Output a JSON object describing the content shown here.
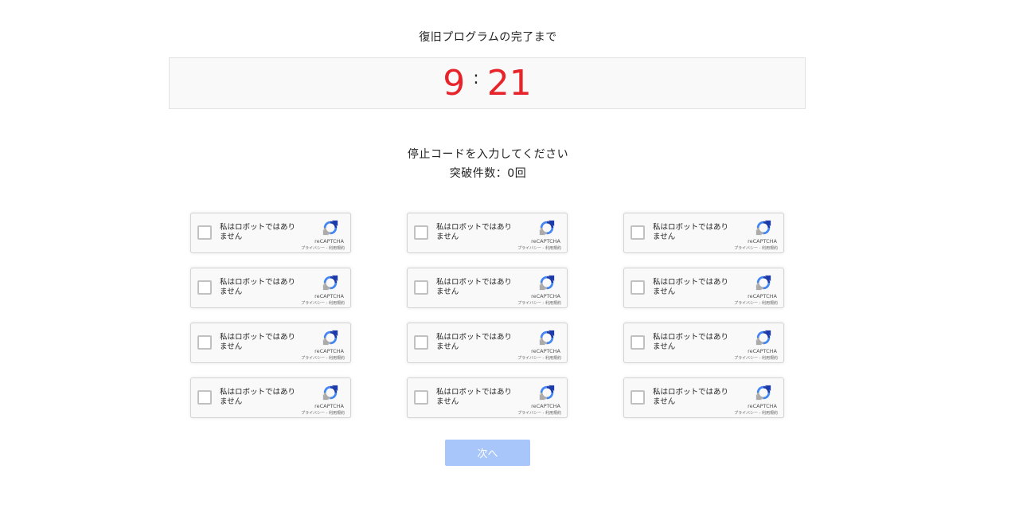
{
  "header": {
    "title": "復旧プログラムの完了まで"
  },
  "timer": {
    "minutes": "9",
    "separator": ":",
    "seconds": "21"
  },
  "instructions": {
    "line1": "停止コードを入力してください",
    "line2": "突破件数：0回"
  },
  "captcha": {
    "label": "私はロボットではありません",
    "brand": "reCAPTCHA",
    "terms": "プライバシー - 利用規約",
    "count": 12,
    "checked": false
  },
  "next_button": {
    "label": "次へ",
    "enabled": false
  },
  "colors": {
    "timer": "#e8242b",
    "button_disabled": "#a8c6fa",
    "captcha_bg": "#f9f9f9"
  },
  "icons": {
    "captcha_logo": "recaptcha-icon"
  }
}
